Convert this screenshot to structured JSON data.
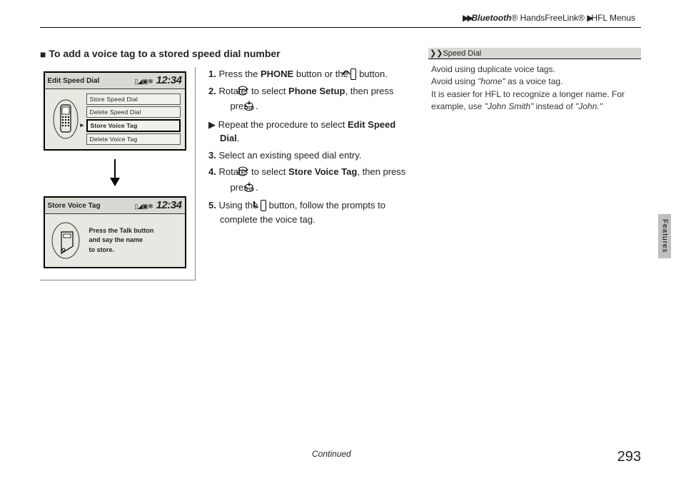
{
  "breadcrumb": {
    "item1": "Bluetooth",
    "reg1": "®",
    "item2": " HandsFreeLink",
    "reg2": "®",
    "item3": "HFL Menus"
  },
  "section_title": "To add a voice tag to a stored speed dial number",
  "screens": {
    "s1": {
      "title": "Edit Speed Dial",
      "status": "▯◢▣✻",
      "time": "12:34",
      "menu": [
        "Store Speed Dial",
        "Delete Speed Dial",
        "Store Voice Tag",
        "Delete Voice Tag"
      ],
      "selected_index": 2
    },
    "s2": {
      "title": "Store Voice Tag",
      "status": "▯◢▣✻",
      "time": "12:34",
      "prompt_l1": "Press the Talk button",
      "prompt_l2": "and say the name",
      "prompt_l3": "to store."
    }
  },
  "steps": {
    "s1a": "Press the ",
    "s1b": "PHONE",
    "s1c": " button or the ",
    "s1d": " button.",
    "s2a": "Rotate ",
    "s2b": " to select ",
    "s2c": "Phone Setup",
    "s2d": ", then press ",
    "s2e": ".",
    "s2sub_a": "Repeat the procedure to select ",
    "s2sub_b": "Edit Speed Dial",
    "s2sub_c": ".",
    "s3": "Select an existing speed dial entry.",
    "s4a": "Rotate ",
    "s4b": " to select ",
    "s4c": "Store Voice Tag",
    "s4d": ", then press ",
    "s4e": ".",
    "s5a": "Using the ",
    "s5b": " button, follow the prompts to complete the voice tag."
  },
  "tipbox": {
    "header": "Speed Dial",
    "l1": "Avoid using duplicate voice tags.",
    "l2a": "Avoid using ",
    "l2b": "\"home\"",
    "l2c": " as a voice tag.",
    "l3a": "It is easier for HFL to recognize a longer name. For example, use ",
    "l3b": "\"John Smith\"",
    "l3c": " instead of ",
    "l3d": "\"John.\""
  },
  "side_tab": "Features",
  "continued": "Continued",
  "page_number": "293"
}
